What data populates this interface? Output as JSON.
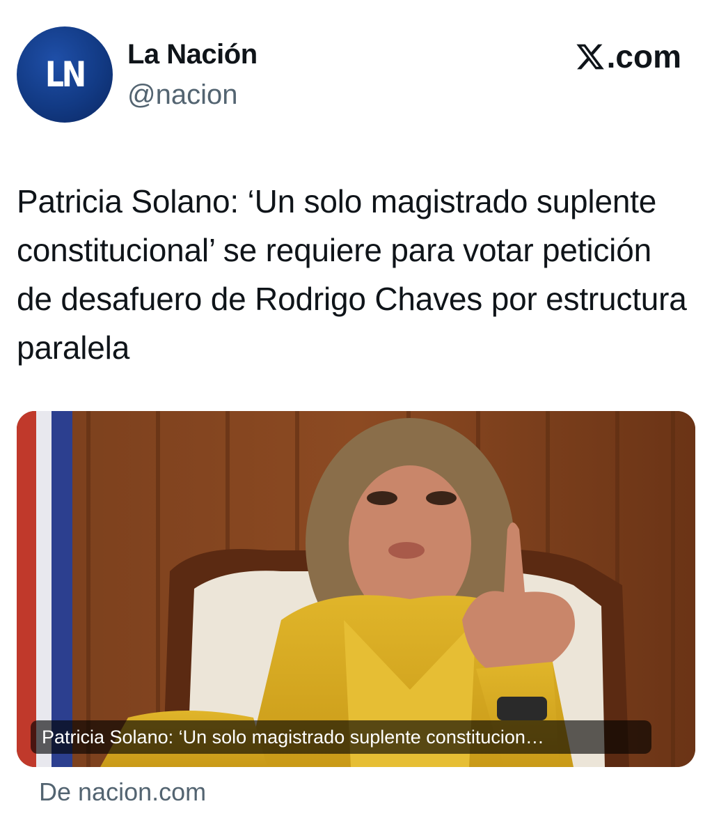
{
  "account": {
    "avatar_text": "LN",
    "name": "La Nación",
    "handle": "@nacion"
  },
  "platform": {
    "label": ".com",
    "icon": "x-logo-icon"
  },
  "tweet": {
    "headline": "Patricia Solano: ‘Un solo magistrado suplente constitucional’ se requiere para votar petición de desafuero de Rodrigo Chaves por estructura paralela"
  },
  "link_card": {
    "caption": "Patricia Solano: ‘Un solo magistrado suplente constitucion…",
    "source": "De nacion.com"
  },
  "colors": {
    "avatar_blue": "#123a84",
    "secondary_text": "#536471",
    "primary_text": "#0f1419"
  }
}
